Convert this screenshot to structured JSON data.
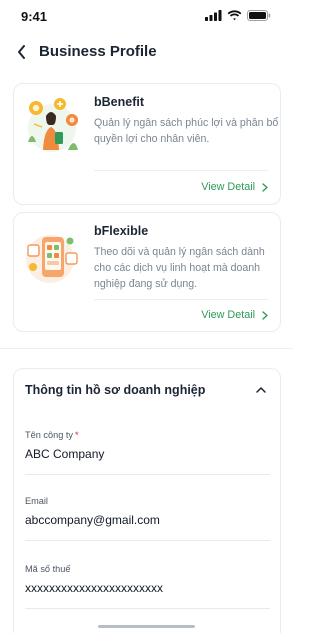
{
  "status_bar": {
    "time": "9:41",
    "icons": [
      "signal-icon",
      "wifi-icon",
      "battery-icon"
    ]
  },
  "header": {
    "back_icon": "chevron-left-icon",
    "title": "Business Profile"
  },
  "cards": [
    {
      "title": "bBenefit",
      "description": "Quản lý ngân sách phúc lợi và phân bổ quyền lợi cho nhân viên.",
      "action": "View Detail",
      "action_icon": "chevron-right-icon"
    },
    {
      "title": "bFlexible",
      "description": "Theo dõi và quản lý ngân sách dành cho các dịch vụ linh hoạt mà doanh nghiệp đang sử dụng.",
      "action": "View Detail",
      "action_icon": "chevron-right-icon"
    }
  ],
  "profile_section": {
    "title": "Thông tin hồ sơ doanh nghiệp",
    "collapse_icon": "chevron-up-icon",
    "fields": [
      {
        "label": "Tên công ty",
        "required_mark": "*",
        "value": "ABC Company"
      },
      {
        "label": "Email",
        "value": "abccompany@gmail.com"
      },
      {
        "label": "Mã số thuế",
        "value": "xxxxxxxxxxxxxxxxxxxxxxx"
      }
    ]
  },
  "colors": {
    "accent_green": "#2f9b5b",
    "required_red": "#e11d48",
    "text_primary": "#1b2534",
    "text_secondary": "#7a8593"
  }
}
